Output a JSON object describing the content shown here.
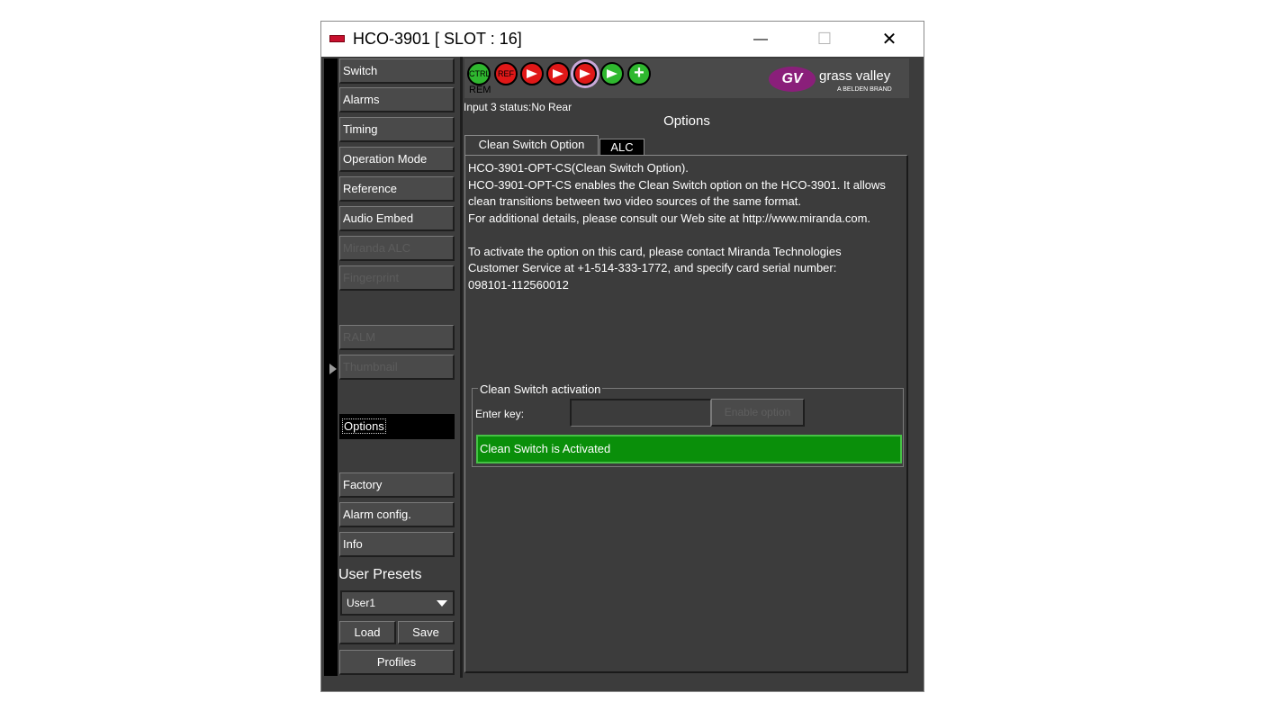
{
  "window": {
    "title": "HCO-3901 [ SLOT : 16]",
    "minimize": "—",
    "maximize": "☐",
    "close": "✕"
  },
  "sidebar": {
    "items": [
      {
        "label": "Switch",
        "state": "enabled"
      },
      {
        "label": "Alarms",
        "state": "enabled"
      },
      {
        "label": "Timing",
        "state": "enabled"
      },
      {
        "label": "Operation Mode",
        "state": "enabled"
      },
      {
        "label": "Reference",
        "state": "enabled"
      },
      {
        "label": "Audio Embed",
        "state": "enabled"
      },
      {
        "label": "Miranda ALC",
        "state": "disabled"
      },
      {
        "label": "Fingerprint",
        "state": "disabled"
      },
      {
        "label": "RALM",
        "state": "disabled"
      },
      {
        "label": "Thumbnail",
        "state": "disabled"
      },
      {
        "label": "Options",
        "state": "selected"
      },
      {
        "label": "Factory",
        "state": "enabled"
      },
      {
        "label": "Alarm config.",
        "state": "enabled"
      },
      {
        "label": "Info",
        "state": "enabled"
      }
    ],
    "user_presets_label": "User Presets",
    "preset_selected": "User1",
    "load_label": "Load",
    "save_label": "Save",
    "profiles_label": "Profiles"
  },
  "status_icons": {
    "ctrl": "CTRL",
    "ref": "REF",
    "rem": "REM"
  },
  "logo": {
    "mark": "GV",
    "name": "grass valley",
    "tagline": "A BELDEN BRAND"
  },
  "main": {
    "input_status": "Input 3 status:No Rear",
    "title": "Options",
    "tabs": [
      {
        "label": "Clean Switch Option",
        "active": true
      },
      {
        "label": "ALC",
        "active": false
      }
    ],
    "description_lines": [
      "HCO-3901-OPT-CS(Clean Switch Option).",
      "HCO-3901-OPT-CS enables the Clean Switch option on the HCO-3901. It allows",
      "clean transitions between two video sources of the same format.",
      "For additional details, please consult our Web site at http://www.miranda.com.",
      "",
      "To activate the option on this card, please contact Miranda Technologies",
      "Customer Service at +1-514-333-1772, and specify card serial number:",
      "098101-112560012"
    ],
    "activation": {
      "group_title": "Clean Switch activation",
      "key_label": "Enter key:",
      "key_value": "",
      "enable_button": "Enable option",
      "status_message": "Clean Switch is Activated"
    }
  },
  "colors": {
    "background": "#3c3c3c",
    "activated_green": "#0a8f0a",
    "status_green": "#2fb82f",
    "status_red": "#e01818",
    "brand_purple": "#8a1f7a"
  }
}
